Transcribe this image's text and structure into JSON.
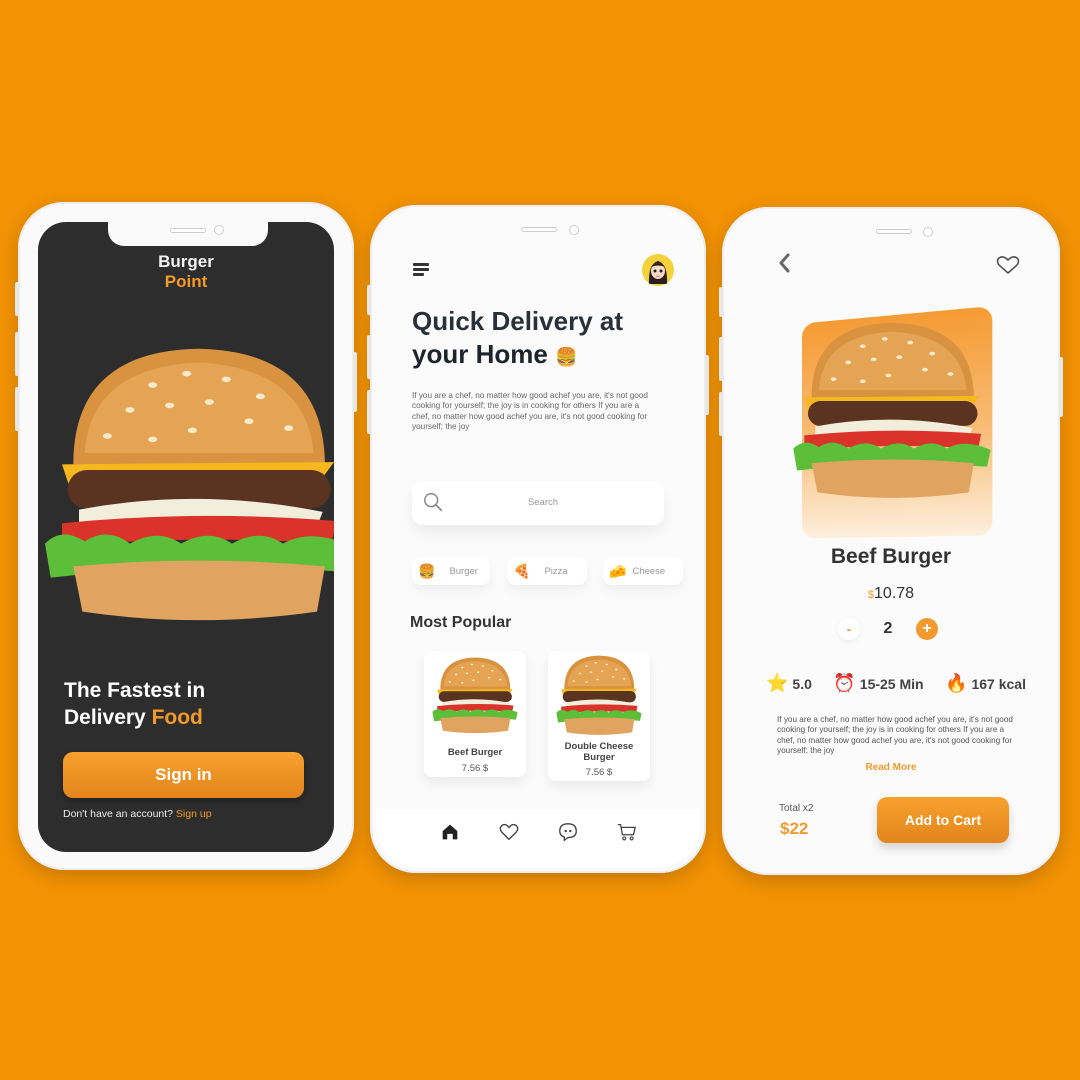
{
  "colors": {
    "background": "#F29204",
    "accent": "#F29A2E",
    "dark_screen": "#2d2d2d"
  },
  "phone1": {
    "brand_line1": "Burger",
    "brand_line2": "Point",
    "hero_line1": "The Fastest in",
    "hero_line2_plain": "Delivery ",
    "hero_line2_accent": "Food",
    "signin_label": "Sign in",
    "no_account_text": "Don't have an account? ",
    "signup_link": "Sign up"
  },
  "phone2": {
    "title_line1": "Quick Delivery at",
    "title_line2": "your Home",
    "title_emoji": "🍔",
    "description": "If you are a chef, no matter how good achef you are, it's not good cooking for yourself; the joy is in cooking for others If you are a chef, no matter how good achef you are, it's not good cooking for yourself; the joy",
    "search_placeholder": "Search",
    "categories": [
      {
        "emoji": "🍔",
        "label": "Burger"
      },
      {
        "emoji": "🍕",
        "label": "Pizza"
      },
      {
        "emoji": "🧀",
        "label": "Cheese"
      }
    ],
    "section_title": "Most Popular",
    "products": [
      {
        "name": "Beef Burger",
        "price": "7.56  $"
      },
      {
        "name": "Double Cheese Burger",
        "price": "7.56  $"
      }
    ],
    "nav": [
      "home-icon",
      "heart-icon",
      "chat-icon",
      "cart-icon"
    ]
  },
  "phone3": {
    "product_name": "Beef Burger",
    "currency": "$",
    "price": "10.78",
    "qty_minus": "-",
    "quantity": "2",
    "qty_plus": "+",
    "rating_emoji": "⭐",
    "rating": "5.0",
    "time_emoji": "⏰",
    "time": "15-25 Min",
    "calories_emoji": "🔥",
    "calories": "167 kcal",
    "description": "If you are a chef, no matter how good achef you are, it's not good cooking for yourself; the joy is in cooking for others If you are a chef, no matter how good achef you are, it's not good cooking for yourself; the joy",
    "read_more": "Read More",
    "total_label": "Total x2",
    "total_value": "$22",
    "add_to_cart": "Add to Cart"
  }
}
